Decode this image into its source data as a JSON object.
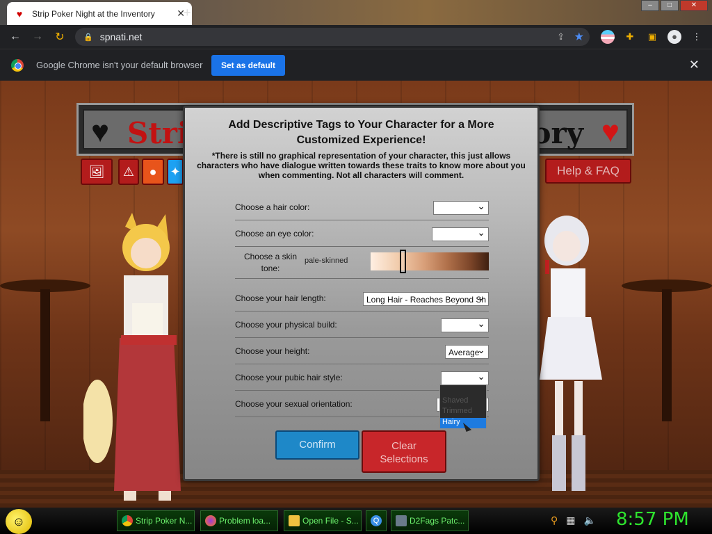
{
  "browser": {
    "tab_title": "Strip Poker Night at the Inventory",
    "url": "spnati.net",
    "infobar_message": "Google Chrome isn't your default browser",
    "set_default_label": "Set as default"
  },
  "site": {
    "banner_left": "Strip",
    "banner_right": "ory",
    "help_label": "Help & FAQ"
  },
  "modal": {
    "title": "Add Descriptive Tags to Your Character for a More Customized Experience!",
    "note": "*There is still no graphical representation of your character, this just allows characters who have dialogue written towards these traits to know more about you when commenting. Not all characters will comment.",
    "rows": {
      "hair_color": {
        "label": "Choose a hair color:",
        "value": ""
      },
      "eye_color": {
        "label": "Choose an eye color:",
        "value": ""
      },
      "skin_tone": {
        "label": "Choose a skin tone:",
        "value": "pale-skinned",
        "level_fraction": 0.26
      },
      "hair_length": {
        "label": "Choose your hair length:",
        "value": "Long Hair - Reaches Beyond Sh"
      },
      "physical_build": {
        "label": "Choose your physical build:",
        "value": ""
      },
      "height": {
        "label": "Choose your height:",
        "value": "Average"
      },
      "pubic_hair": {
        "label": "Choose your pubic hair style:",
        "value": ""
      },
      "orientation": {
        "label": "Choose your sexual orientation:",
        "value": ""
      }
    },
    "dropdown_options": [
      "Shaved",
      "Trimmed",
      "Hairy"
    ],
    "dropdown_highlighted": "Hairy",
    "confirm_label": "Confirm",
    "clear_label_line1": "Clear",
    "clear_label_line2": "Selections"
  },
  "taskbar": {
    "items": [
      {
        "label": "Strip Poker N...",
        "icon": "chrome-icon"
      },
      {
        "label": "Problem loa...",
        "icon": "firefox-icon"
      },
      {
        "label": "Open File - S...",
        "icon": "folder-icon"
      },
      {
        "label": "",
        "icon": "app-icon"
      },
      {
        "label": "D2Fags Patc...",
        "icon": "image-icon"
      }
    ],
    "clock": "8:57 PM"
  },
  "colors": {
    "confirm": "#1e88c8",
    "clear": "#c8262a",
    "chrome_blue": "#1a73e8",
    "clock_green": "#2ee52e"
  }
}
